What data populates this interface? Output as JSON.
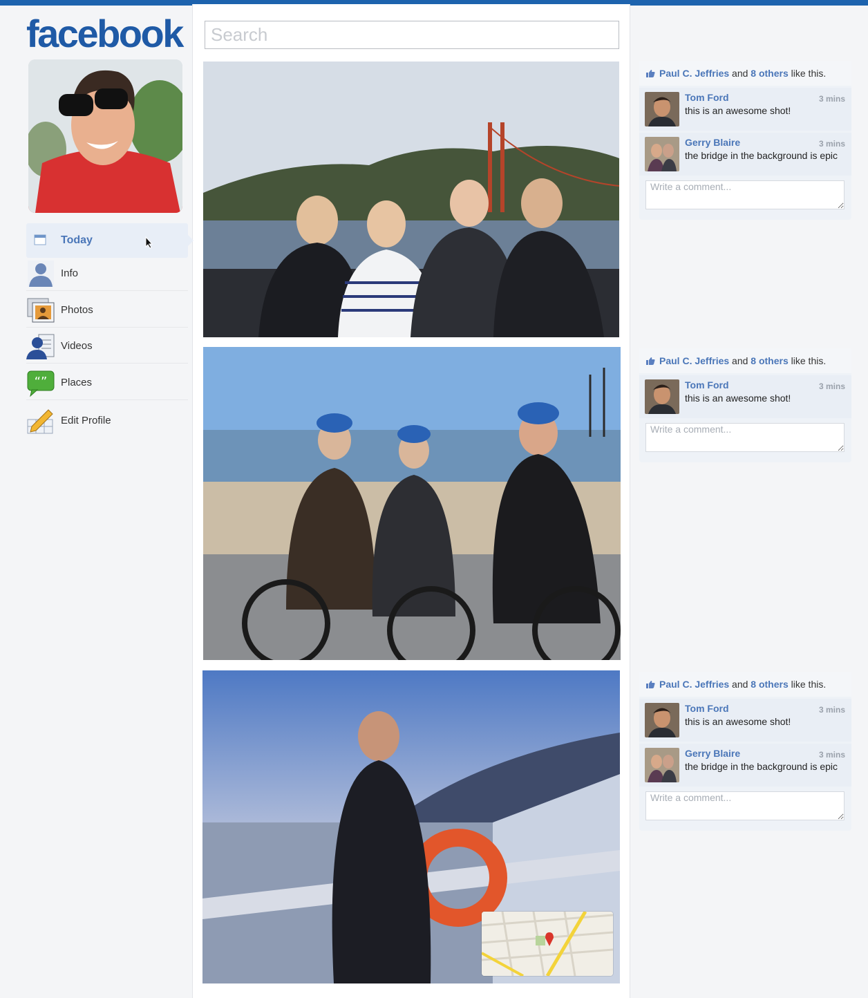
{
  "app": {
    "logo_text": "facebook",
    "accent": "#1d63ae",
    "link_color": "#4a76b8"
  },
  "search": {
    "placeholder": "Search",
    "value": ""
  },
  "nav": {
    "items": [
      {
        "label": "Today",
        "icon": "calendar-icon",
        "active": true
      },
      {
        "label": "Info",
        "icon": "person-icon"
      },
      {
        "label": "Photos",
        "icon": "photos-icon"
      },
      {
        "label": "Videos",
        "icon": "videos-icon"
      },
      {
        "label": "Places",
        "icon": "speech-bubble-icon"
      },
      {
        "label": "Edit Profile",
        "icon": "pencil-icon"
      }
    ]
  },
  "posts": [
    {
      "photo_desc": "group-photo-golden-gate",
      "likes": {
        "first": "Paul C. Jeffries",
        "and": "and",
        "others": "8 others",
        "suffix": "like this."
      },
      "comments": [
        {
          "name": "Tom Ford",
          "time": "3 mins",
          "text": "this is an awesome shot!"
        },
        {
          "name": "Gerry Blaire",
          "time": "3 mins",
          "text": "the bridge in the background is epic"
        }
      ],
      "write_placeholder": "Write a comment..."
    },
    {
      "photo_desc": "bike-ride-beach",
      "likes": {
        "first": "Paul C. Jeffries",
        "and": "and",
        "others": "8 others",
        "suffix": "like this."
      },
      "comments": [
        {
          "name": "Tom Ford",
          "time": "3 mins",
          "text": "this is an awesome shot!"
        }
      ],
      "write_placeholder": "Write a comment..."
    },
    {
      "photo_desc": "ferry-evening",
      "likes": {
        "first": "Paul C. Jeffries",
        "and": "and",
        "others": "8 others",
        "suffix": "like this."
      },
      "comments": [
        {
          "name": "Tom Ford",
          "time": "3 mins",
          "text": "this is an awesome shot!"
        },
        {
          "name": "Gerry Blaire",
          "time": "3 mins",
          "text": "the bridge in the background is epic"
        }
      ],
      "write_placeholder": "Write a comment..."
    }
  ]
}
